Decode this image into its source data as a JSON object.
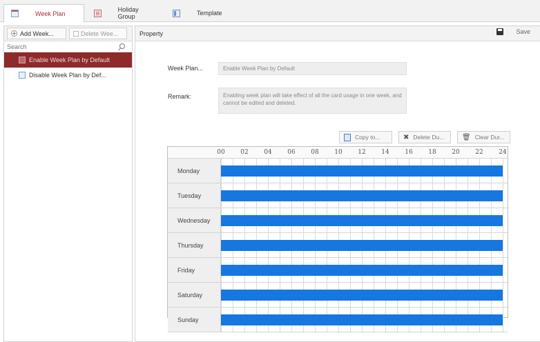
{
  "tabs": [
    {
      "label": "Week Plan",
      "icon": "calendar-icon"
    },
    {
      "label": "Holiday Group",
      "icon": "holiday-book-icon"
    },
    {
      "label": "Template",
      "icon": "template-icon"
    }
  ],
  "left": {
    "add_label": "Add Week...",
    "delete_label": "Delete Wee...",
    "search_placeholder": "Search",
    "plans": [
      {
        "label": "Enable Week Plan by Default",
        "selected": true
      },
      {
        "label": "Disable Week Plan by Def...",
        "selected": false
      }
    ]
  },
  "right": {
    "title": "Property",
    "save_label": "Save",
    "week_plan_label": "Week Plan...",
    "week_plan_value": "Enable Week Plan by Default",
    "remark_label": "Remark:",
    "remark_value": "Enabling week plan will take effect of all the card usage in one week, and cannot be edited and deleted.",
    "copy_label": "Copy to...",
    "delete_label": "Delete Du...",
    "clear_label": "Clear Dur..."
  },
  "schedule": {
    "hours": [
      "00",
      "02",
      "04",
      "06",
      "08",
      "10",
      "12",
      "14",
      "16",
      "18",
      "20",
      "22",
      "24"
    ],
    "days": [
      {
        "name": "Monday",
        "start": 0,
        "end": 24
      },
      {
        "name": "Tuesday",
        "start": 0,
        "end": 24
      },
      {
        "name": "Wednesday",
        "start": 0,
        "end": 24
      },
      {
        "name": "Thursday",
        "start": 0,
        "end": 24
      },
      {
        "name": "Friday",
        "start": 0,
        "end": 24
      },
      {
        "name": "Saturday",
        "start": 0,
        "end": 24
      },
      {
        "name": "Sunday",
        "start": 0,
        "end": 24
      }
    ],
    "bar_color": "#1677e0"
  },
  "colors": {
    "accent": "#b3262b",
    "selected_bg": "#8f2a2a"
  }
}
